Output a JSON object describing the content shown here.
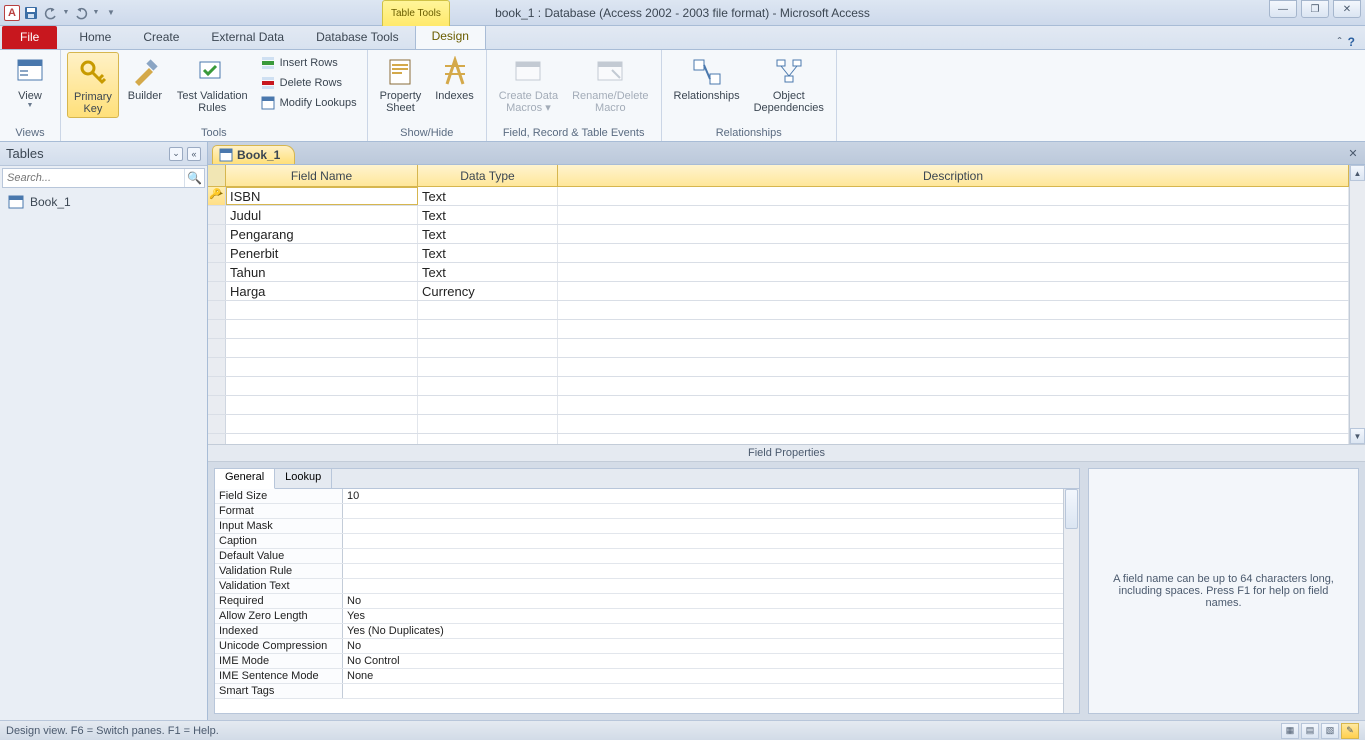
{
  "title": "book_1 : Database (Access 2002 - 2003 file format)  -  Microsoft Access",
  "tabtools": "Table Tools",
  "ribbon_tabs": {
    "file": "File",
    "home": "Home",
    "create": "Create",
    "external": "External Data",
    "dbtools": "Database Tools",
    "design": "Design"
  },
  "ribbon": {
    "views": {
      "view": "View",
      "group": "Views"
    },
    "tools": {
      "primary_key": "Primary\nKey",
      "builder": "Builder",
      "test_validation": "Test Validation\nRules",
      "insert_rows": "Insert Rows",
      "delete_rows": "Delete Rows",
      "modify_lookups": "Modify Lookups",
      "group": "Tools"
    },
    "showhide": {
      "property_sheet": "Property\nSheet",
      "indexes": "Indexes",
      "group": "Show/Hide"
    },
    "events": {
      "create_macros": "Create Data\nMacros ▾",
      "rename_delete": "Rename/Delete\nMacro",
      "group": "Field, Record & Table Events"
    },
    "relationships": {
      "relationships": "Relationships",
      "obj_deps": "Object\nDependencies",
      "group": "Relationships"
    }
  },
  "nav": {
    "heading": "Tables",
    "search_placeholder": "Search...",
    "items": [
      "Book_1"
    ]
  },
  "doc_tab": "Book_1",
  "grid": {
    "headers": {
      "field_name": "Field Name",
      "data_type": "Data Type",
      "description": "Description"
    },
    "rows": [
      {
        "name": "ISBN",
        "type": "Text",
        "pk": true,
        "current": true
      },
      {
        "name": "Judul",
        "type": "Text"
      },
      {
        "name": "Pengarang",
        "type": "Text"
      },
      {
        "name": "Penerbit",
        "type": "Text"
      },
      {
        "name": "Tahun",
        "type": "Text"
      },
      {
        "name": "Harga",
        "type": "Currency"
      }
    ],
    "blank_rows": 8
  },
  "field_properties_label": "Field Properties",
  "fp_tabs": {
    "general": "General",
    "lookup": "Lookup"
  },
  "fp": [
    {
      "k": "Field Size",
      "v": "10"
    },
    {
      "k": "Format",
      "v": ""
    },
    {
      "k": "Input Mask",
      "v": ""
    },
    {
      "k": "Caption",
      "v": ""
    },
    {
      "k": "Default Value",
      "v": ""
    },
    {
      "k": "Validation Rule",
      "v": ""
    },
    {
      "k": "Validation Text",
      "v": ""
    },
    {
      "k": "Required",
      "v": "No"
    },
    {
      "k": "Allow Zero Length",
      "v": "Yes"
    },
    {
      "k": "Indexed",
      "v": "Yes (No Duplicates)"
    },
    {
      "k": "Unicode Compression",
      "v": "No"
    },
    {
      "k": "IME Mode",
      "v": "No Control"
    },
    {
      "k": "IME Sentence Mode",
      "v": "None"
    },
    {
      "k": "Smart Tags",
      "v": ""
    }
  ],
  "fp_help": "A field name can be up to 64 characters long, including spaces. Press F1 for help on field names.",
  "status": "Design view.   F6 = Switch panes.   F1 = Help."
}
